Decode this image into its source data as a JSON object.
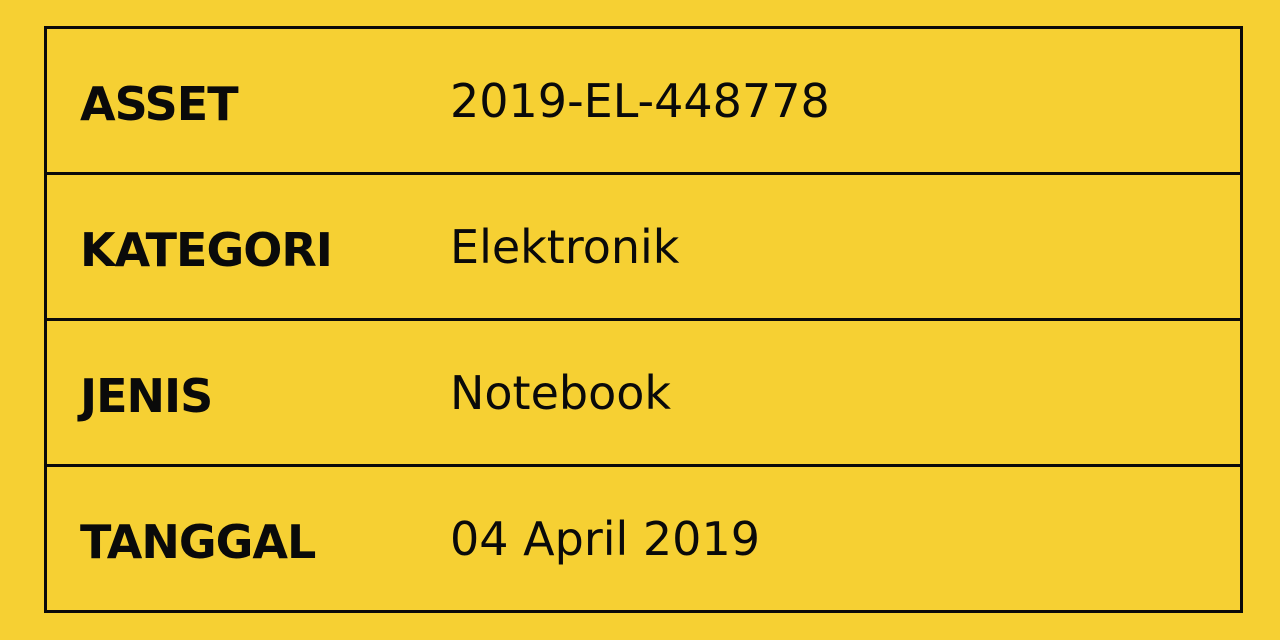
{
  "rows": [
    {
      "label": "ASSET",
      "value": "2019-EL-448778"
    },
    {
      "label": "KATEGORI",
      "value": "Elektronik"
    },
    {
      "label": "JENIS",
      "value": "Notebook"
    },
    {
      "label": "TANGGAL",
      "value": "04 April 2019"
    }
  ],
  "colors": {
    "background": "#f6d033",
    "border": "#0a0a0a",
    "text": "#0a0a0a"
  }
}
